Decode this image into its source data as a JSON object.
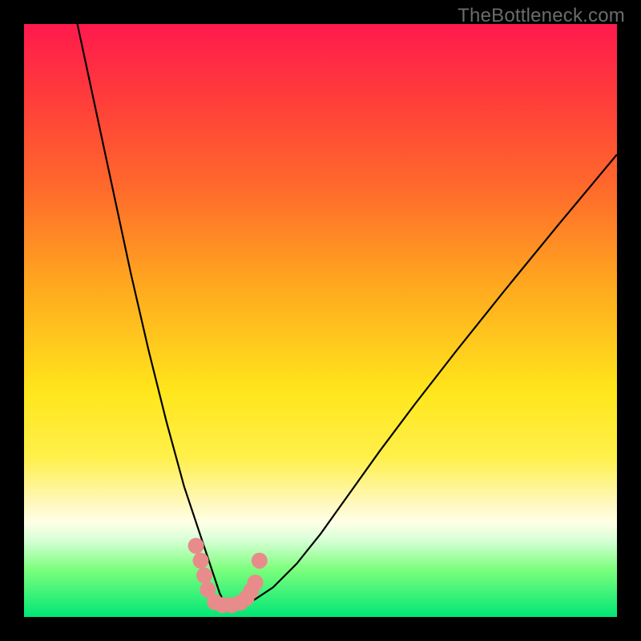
{
  "watermark": "TheBottleneck.com",
  "chart_data": {
    "type": "line",
    "title": "",
    "xlabel": "",
    "ylabel": "",
    "xlim": [
      0,
      100
    ],
    "ylim": [
      0,
      100
    ],
    "series": [
      {
        "name": "bottleneck-curve",
        "x": [
          9,
          12,
          15,
          18,
          21,
          24,
          27,
          30,
          32,
          33,
          34,
          35,
          37,
          39,
          42,
          46,
          50,
          55,
          60,
          66,
          73,
          81,
          90,
          100
        ],
        "values": [
          100,
          86,
          72,
          58,
          45,
          33,
          22,
          13,
          7,
          4,
          2,
          2,
          2,
          3,
          5,
          9,
          14,
          21,
          28,
          36,
          45,
          55,
          66,
          78
        ]
      },
      {
        "name": "highlight-dots",
        "x": [
          29.0,
          29.8,
          30.4,
          31.0,
          32.2,
          33.5,
          35.0,
          36.5,
          37.5,
          38.3,
          39.0,
          39.7
        ],
        "values": [
          12.0,
          9.5,
          7.0,
          4.6,
          2.5,
          2.0,
          2.0,
          2.4,
          3.2,
          4.4,
          5.8,
          9.5
        ]
      }
    ],
    "colors": {
      "curve": "#000000",
      "dots": "#e88b8b",
      "gradient_top": "#ff1a4d",
      "gradient_bottom": "#00e676"
    }
  }
}
